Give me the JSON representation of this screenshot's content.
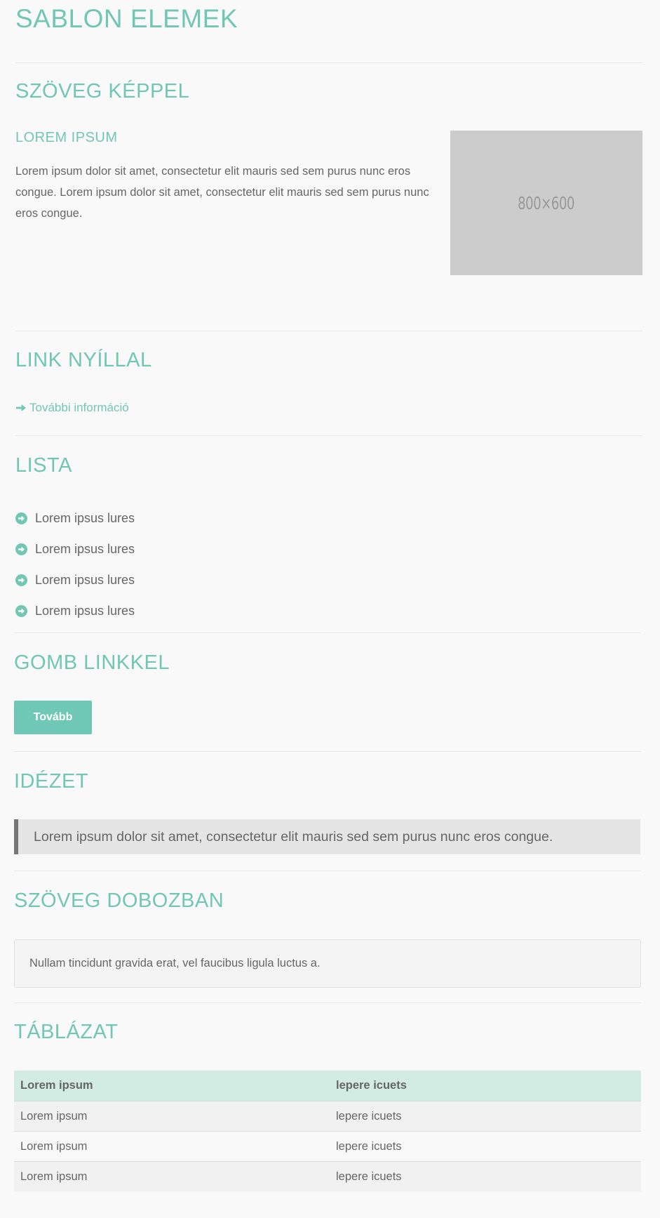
{
  "page": {
    "title": "SABLON ELEMEK"
  },
  "sections": {
    "text_with_image": {
      "heading": "SZÖVEG KÉPPEL",
      "subheading": "LOREM IPSUM",
      "paragraph": "Lorem ipsum dolor sit amet, consectetur elit mauris sed sem purus nunc eros congue. Lorem ipsum dolor sit amet, consectetur elit mauris sed sem purus nunc eros congue.",
      "image_label": "800×600"
    },
    "link_with_arrow": {
      "heading": "LINK NYÍLLAL",
      "link_text": "További információ",
      "icon": "arrow-right-icon"
    },
    "list": {
      "heading": "LISTA",
      "icon": "arrow-circle-right-icon",
      "items": [
        "Lorem ipsus lures",
        "Lorem ipsus lures",
        "Lorem ipsus lures",
        "Lorem ipsus lures"
      ]
    },
    "button_with_link": {
      "heading": "GOMB LINKKEL",
      "button_label": "Tovább"
    },
    "quote": {
      "heading": "IDÉZET",
      "text": "Lorem ipsum dolor sit amet, consectetur elit mauris sed sem purus nunc eros congue."
    },
    "text_in_box": {
      "heading": "SZÖVEG DOBOZBAN",
      "text": "Nullam tincidunt gravida erat, vel faucibus ligula luctus a."
    },
    "table": {
      "heading": "TÁBLÁZAT",
      "columns": [
        "Lorem ipsum",
        "lepere icuets"
      ],
      "rows": [
        [
          "Lorem ipsum",
          "lepere icuets"
        ],
        [
          "Lorem ipsum",
          "lepere icuets"
        ],
        [
          "Lorem ipsum",
          "lepere icuets"
        ]
      ]
    }
  },
  "colors": {
    "accent": "#72c6b4",
    "button": "#6fc7b5",
    "background": "#f9f9f9",
    "text": "#666666",
    "table_header": "#d2ebe3",
    "quote_bar": "#777777",
    "image_placeholder": "#cccccc"
  }
}
